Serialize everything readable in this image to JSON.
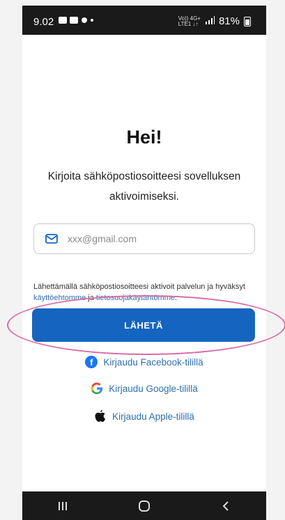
{
  "status_bar": {
    "time": "9.02",
    "network_mini": "Vo)) 4G+\nLTE1 ↓↑",
    "battery_percent": "81%"
  },
  "main": {
    "title": "Hei!",
    "subtitle": "Kirjoita sähköpostiosoitteesi sovelluksen aktivoimiseksi.",
    "email_placeholder": "xxx@gmail.com",
    "terms_prefix": "Lähettämällä sähköpostiosoitteesi aktivoit palvelun ja hyväksyt ",
    "terms_link1": "käyttöehtomme",
    "terms_mid": " ja ",
    "terms_link2": "tietosuojakäytäntömme",
    "terms_suffix": ".",
    "send_button": "LÄHETÄ",
    "facebook_login": "Kirjaudu Facebook-tilillä",
    "google_login": "Kirjaudu Google-tilillä",
    "apple_login": "Kirjaudu Apple-tilillä"
  },
  "colors": {
    "primary": "#1565c0",
    "link": "#2d6fb0",
    "annotation": "#d96aa6"
  },
  "icons": {
    "mail": "mail-icon",
    "facebook": "facebook-icon",
    "google": "google-icon",
    "apple": "apple-icon",
    "recent_apps": "recent-apps-icon",
    "home": "home-icon",
    "back": "back-icon"
  }
}
